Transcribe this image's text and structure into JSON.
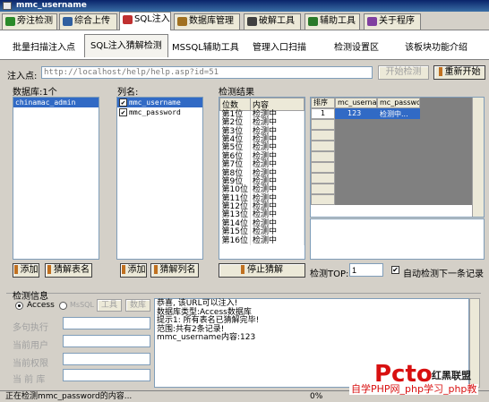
{
  "window": {
    "title": "mmc_username"
  },
  "tabs": [
    {
      "label": "旁注检测",
      "icon_color": "#2a8a2a",
      "active": false
    },
    {
      "label": "综合上传",
      "icon_color": "#3060a0",
      "active": false
    },
    {
      "label": "SQL注入",
      "icon_color": "#c03030",
      "active": true
    },
    {
      "label": "数据库管理",
      "icon_color": "#a07020",
      "active": false
    },
    {
      "label": "破解工具",
      "icon_color": "#404040",
      "active": false
    },
    {
      "label": "辅助工具",
      "icon_color": "#2a7a2a",
      "active": false
    },
    {
      "label": "关于程序",
      "icon_color": "#8040a0",
      "active": false
    }
  ],
  "subnav": [
    {
      "label": "批量扫描注入点",
      "active": false
    },
    {
      "label": "SQL注入猜解检测",
      "active": true
    },
    {
      "label": "MSSQL辅助工具",
      "active": false
    },
    {
      "label": "管理入口扫描",
      "active": false
    },
    {
      "label": "检测设置区",
      "active": false
    },
    {
      "label": "该板块功能介绍",
      "active": false
    }
  ],
  "injection": {
    "label": "注入点:",
    "url": "http://localhost/help/help.asp?id=51",
    "start_button": "开始检测",
    "restart_button": "重新开始"
  },
  "database": {
    "label": "数据库:1个",
    "items": [
      "chinamac_admin"
    ],
    "add_button": "添加",
    "guess_button": "猜解表名"
  },
  "columns": {
    "label": "列名:",
    "items": [
      {
        "name": "mmc_username",
        "checked": true
      },
      {
        "name": "mmc_password",
        "checked": true
      }
    ],
    "add_button": "添加",
    "guess_button": "猜解列名"
  },
  "results": {
    "label": "检测结果",
    "headers": [
      "位数",
      "内容"
    ],
    "rows": [
      [
        "第1位",
        "检测中"
      ],
      [
        "第2位",
        "检测中"
      ],
      [
        "第3位",
        "检测中"
      ],
      [
        "第4位",
        "检测中"
      ],
      [
        "第5位",
        "检测中"
      ],
      [
        "第6位",
        "检测中"
      ],
      [
        "第7位",
        "检测中"
      ],
      [
        "第8位",
        "检测中"
      ],
      [
        "第9位",
        "检测中"
      ],
      [
        "第10位",
        "检测中"
      ],
      [
        "第11位",
        "检测中"
      ],
      [
        "第12位",
        "检测中"
      ],
      [
        "第13位",
        "检测中"
      ],
      [
        "第14位",
        "检测中"
      ],
      [
        "第15位",
        "检测中"
      ],
      [
        "第16位",
        "检测中"
      ]
    ],
    "stop_button": "停止猜解"
  },
  "record_grid": {
    "headers": [
      "排序",
      "mc_usernam",
      "mc_passwor"
    ],
    "rows": [
      [
        "1",
        "123",
        "检测中..."
      ]
    ]
  },
  "detect_top": {
    "label": "检测TOP:",
    "value": "1",
    "auto_label": "自动检测下一条记录",
    "auto_checked": true
  },
  "info": {
    "label": "检测信息",
    "radio_access": "Access",
    "radio_mssql": "MsSQL",
    "tool_button": "工具",
    "db_button": "数库",
    "fields": [
      "多句执行",
      "当前用户",
      "当前权限",
      "当 前 库"
    ],
    "log_lines": [
      "恭喜, 该URL可以注入!",
      "数据库类型:Access数据库",
      "提示1: 所有表名已猜解完毕!",
      "范围:共有2条记录!",
      "mmc_username内容:123"
    ]
  },
  "status": {
    "text": "正在检测mmc_password的内容...",
    "percent": "0%"
  },
  "watermark": {
    "top": "红黑联盟",
    "bottom": "自学PHP网_php学习_php教"
  }
}
